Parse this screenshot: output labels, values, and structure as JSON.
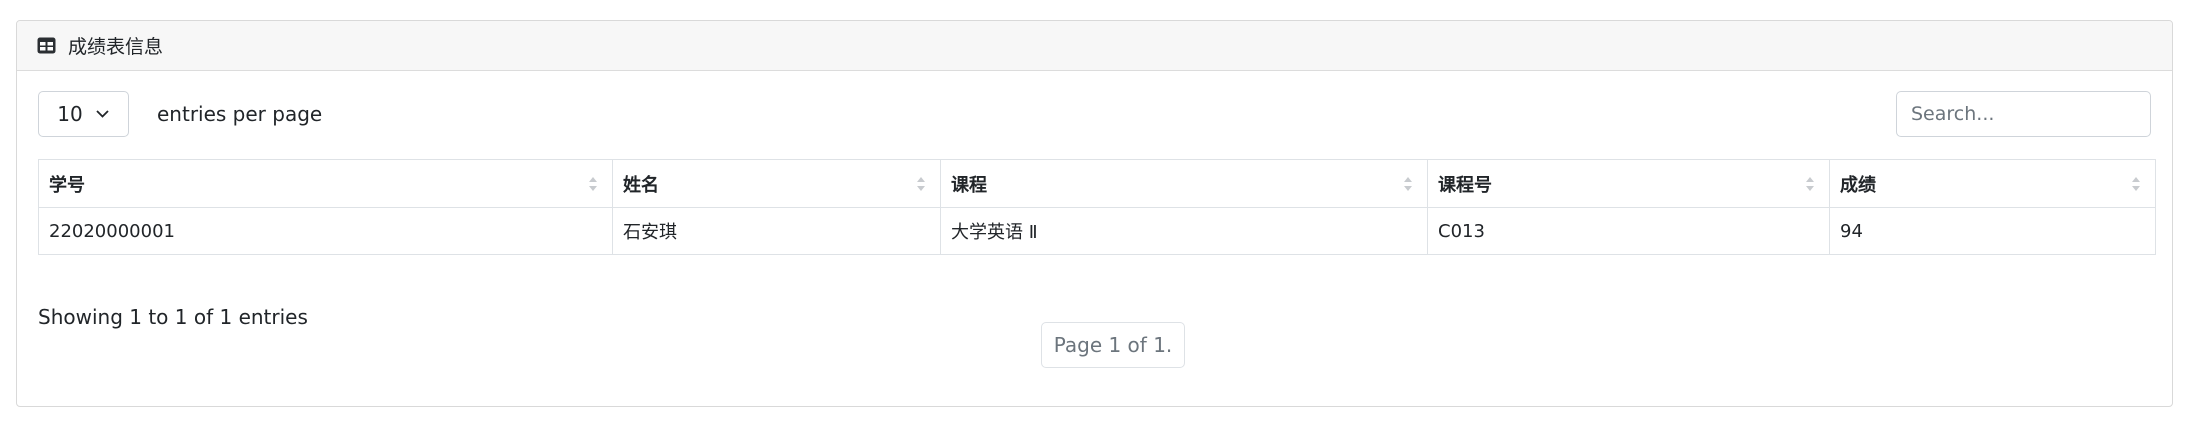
{
  "card": {
    "title": "成绩表信息",
    "icon": "table-icon"
  },
  "controls": {
    "per_page_value": "10",
    "per_page_label": "entries per page",
    "search_placeholder": "Search..."
  },
  "table": {
    "columns": [
      "学号",
      "姓名",
      "课程",
      "课程号",
      "成绩"
    ],
    "rows": [
      [
        "22020000001",
        "石安琪",
        "大学英语 Ⅱ",
        "C013",
        "94"
      ]
    ]
  },
  "footer": {
    "info": "Showing 1 to 1 of 1 entries",
    "pagination": "Page 1 of 1."
  },
  "colors": {
    "border": "#dee2e6",
    "header_bg": "#f7f7f7",
    "muted": "#6c757d"
  }
}
